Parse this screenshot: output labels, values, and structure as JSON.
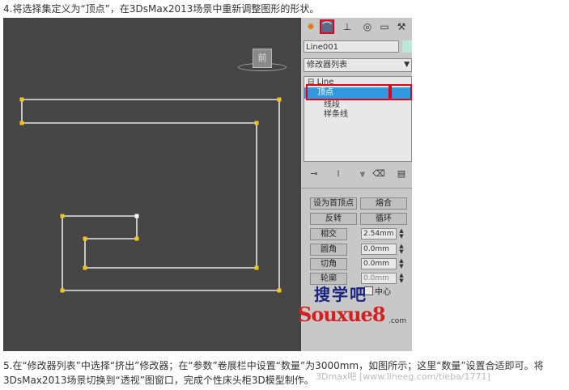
{
  "captions": {
    "top": "4.将选择集定义为“顶点”，在3DsMax2013场景中重新调整图形的形状。",
    "bottom": "5.在“修改器列表”中选择“挤出”修改器；在“参数”卷展栏中设置“数量”为3000mm，如图所示；这里“数量”设置合适即可。将3DsMax2013场景切换到“透视”图窗口，完成个性床头柜3D模型制作。"
  },
  "viewport": {
    "viewcube_label": "前"
  },
  "command_panel": {
    "tabs": [
      "create",
      "modify",
      "hierarchy",
      "motion",
      "display",
      "utilities"
    ],
    "active_tab": "modify",
    "object_name": "Line001",
    "object_color": "#bde8d8",
    "modifier_list_label": "修改器列表",
    "stack": {
      "root": "Line",
      "items": [
        "顶点",
        "线段",
        "样条线"
      ],
      "selected": "顶点"
    },
    "geometry": {
      "make_first_button": "设为首顶点",
      "fuse_button": "熔合",
      "reverse_button": "反转",
      "cycle_button": "循环",
      "cross_insert_label": "相交",
      "cross_insert_value": "2.54mm",
      "fillet_label": "圆角",
      "fillet_value": "0.0mm",
      "chamfer_label": "切角",
      "chamfer_value": "0.0mm",
      "outline_label": "轮廓",
      "outline_value": "0.0mm",
      "center_label": "中心"
    }
  },
  "watermark": {
    "cn": "搜学吧",
    "en": "Souxue8",
    "suffix": ".com",
    "url": "3Dmax吧 [www.lineeg.com/tieba/1771]"
  },
  "colors": {
    "viewport_bg": "#454545",
    "shape_line": "#e6e6e6",
    "vertex": "#f2c31a",
    "highlight": "#e0001c",
    "selection": "#3399dd"
  }
}
